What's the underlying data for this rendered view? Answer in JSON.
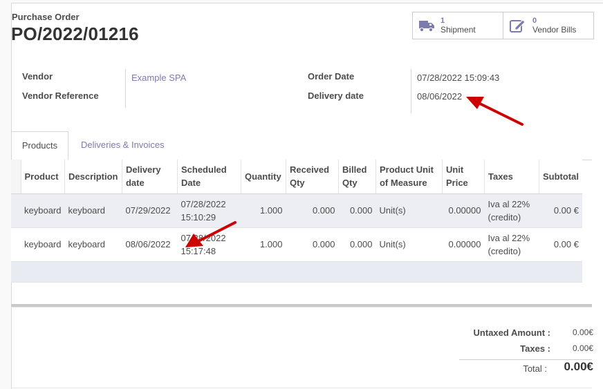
{
  "header": {
    "label": "Purchase Order",
    "name": "PO/2022/01216"
  },
  "smart_buttons": [
    {
      "count": "1",
      "label": "Shipment",
      "icon": "truck-icon"
    },
    {
      "count": "0",
      "label": "Vendor Bills",
      "icon": "edit-icon"
    }
  ],
  "fields": {
    "vendor_label": "Vendor",
    "vendor_value": "Example SPA",
    "vendor_ref_label": "Vendor Reference",
    "vendor_ref_value": "",
    "order_date_label": "Order Date",
    "order_date_value": "07/28/2022 15:09:43",
    "delivery_date_label": "Delivery date",
    "delivery_date_value": "08/06/2022"
  },
  "tabs": [
    {
      "label": "Products",
      "active": true
    },
    {
      "label": "Deliveries & Invoices",
      "active": false
    }
  ],
  "table": {
    "headers": [
      "Product",
      "Description",
      "Delivery date",
      "Scheduled Date",
      "Quantity",
      "Received Qty",
      "Billed Qty",
      "Product Unit of Measure",
      "Unit Price",
      "Taxes",
      "Subtotal"
    ],
    "rows": [
      {
        "product": "keyboard",
        "description": "keyboard",
        "delivery_date": "07/29/2022",
        "scheduled_date": "07/28/2022",
        "scheduled_time": "15:10:29",
        "quantity": "1.000",
        "received": "0.000",
        "billed": "0.000",
        "uom": "Unit(s)",
        "unit_price": "0.00000",
        "taxes_1": "Iva al 22%",
        "taxes_2": "(credito)",
        "subtotal": "0.00 €"
      },
      {
        "product": "keyboard",
        "description": "keyboard",
        "delivery_date": "08/06/2022",
        "scheduled_date": "07/28/2022",
        "scheduled_time": "15:17:48",
        "quantity": "1.000",
        "received": "0.000",
        "billed": "0.000",
        "uom": "Unit(s)",
        "unit_price": "0.00000",
        "taxes_1": "Iva al 22%",
        "taxes_2": "(credito)",
        "subtotal": "0.00 €"
      }
    ]
  },
  "totals": {
    "untaxed_label": "Untaxed Amount :",
    "untaxed_value": "0.00€",
    "taxes_label": "Taxes :",
    "taxes_value": "0.00€",
    "total_label": "Total :",
    "total_value": "0.00€"
  },
  "colors": {
    "link": "#7c7bad",
    "arrow": "#cc0000",
    "row_highlight": "#eceef4"
  }
}
